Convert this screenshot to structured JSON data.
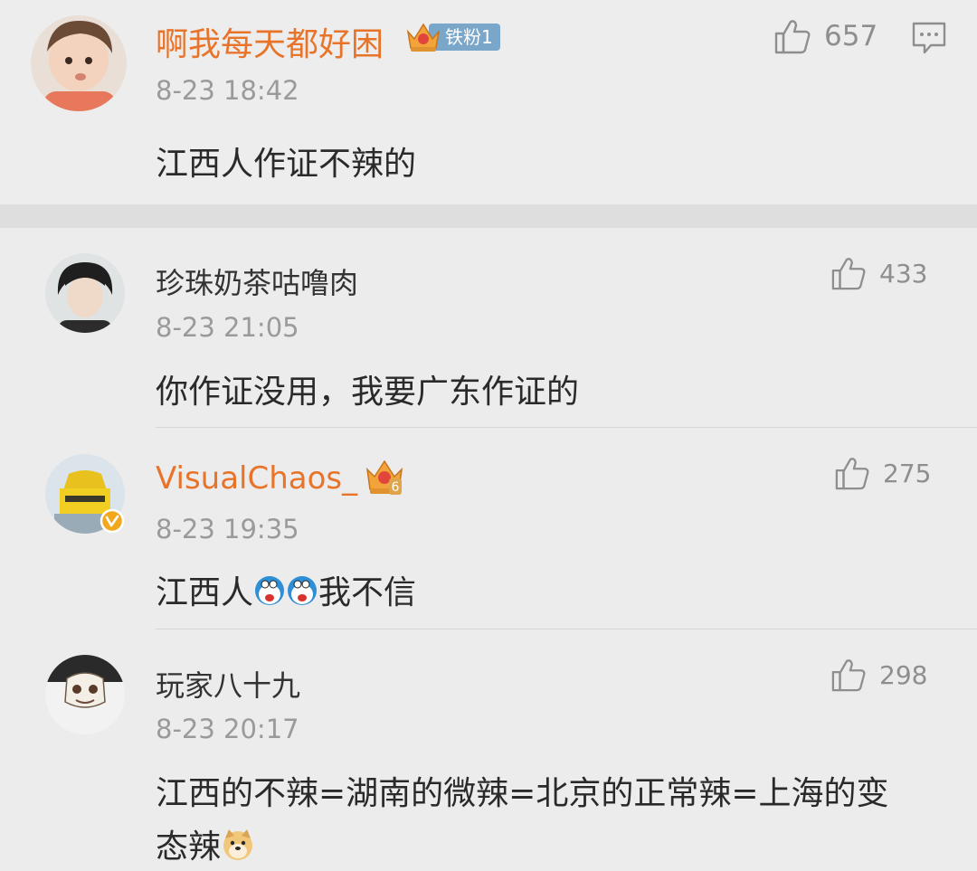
{
  "comments": [
    {
      "username": "啊我每天都好困",
      "fan_badge": "铁粉1",
      "timestamp": "8-23 18:42",
      "text": "江西人作证不辣的",
      "likes": "657"
    },
    {
      "username": "珍珠奶茶咕噜肉",
      "timestamp": "8-23 21:05",
      "text": "你作证没用，我要广东作证的",
      "likes": "433"
    },
    {
      "username": "VisualChaos_",
      "crown_level": "6",
      "timestamp": "8-23 19:35",
      "text_before": "江西人",
      "text_after": "我不信",
      "likes": "275"
    },
    {
      "username": "玩家八十九",
      "timestamp": "8-23 20:17",
      "text_line1": "江西的不辣=湖南的微辣=北京的正常辣=上海的变",
      "text_line2": "态辣",
      "likes": "298"
    }
  ],
  "colors": {
    "username_vip": "#e8742a",
    "username_normal": "#333333",
    "timestamp": "#9a9a9a",
    "body_text": "#2a2a2a",
    "fan_badge": "#7aa7c9",
    "verified": "#f2a81d"
  },
  "icons": [
    "thumbs-up-icon",
    "comment-reply-icon",
    "crown-icon",
    "verified-icon",
    "doraemon-emoji",
    "doge-emoji"
  ]
}
